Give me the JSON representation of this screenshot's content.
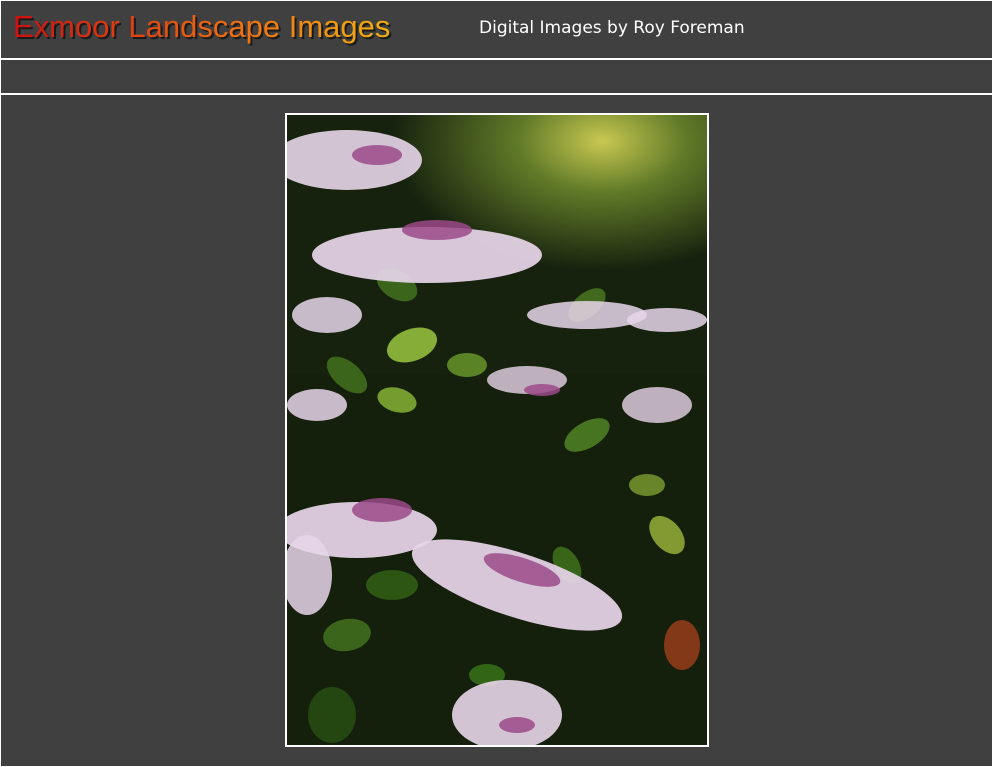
{
  "header": {
    "title": "Exmoor Landscape Images",
    "subtitle": "Digital Images by Roy Foreman"
  },
  "main": {
    "image": {
      "alt": "Lacecap hydrangea flowers"
    }
  },
  "colors": {
    "background": "#404040",
    "border": "#ffffff",
    "title_gradient_start": "#cc1010",
    "title_gradient_end": "#f2b010"
  }
}
